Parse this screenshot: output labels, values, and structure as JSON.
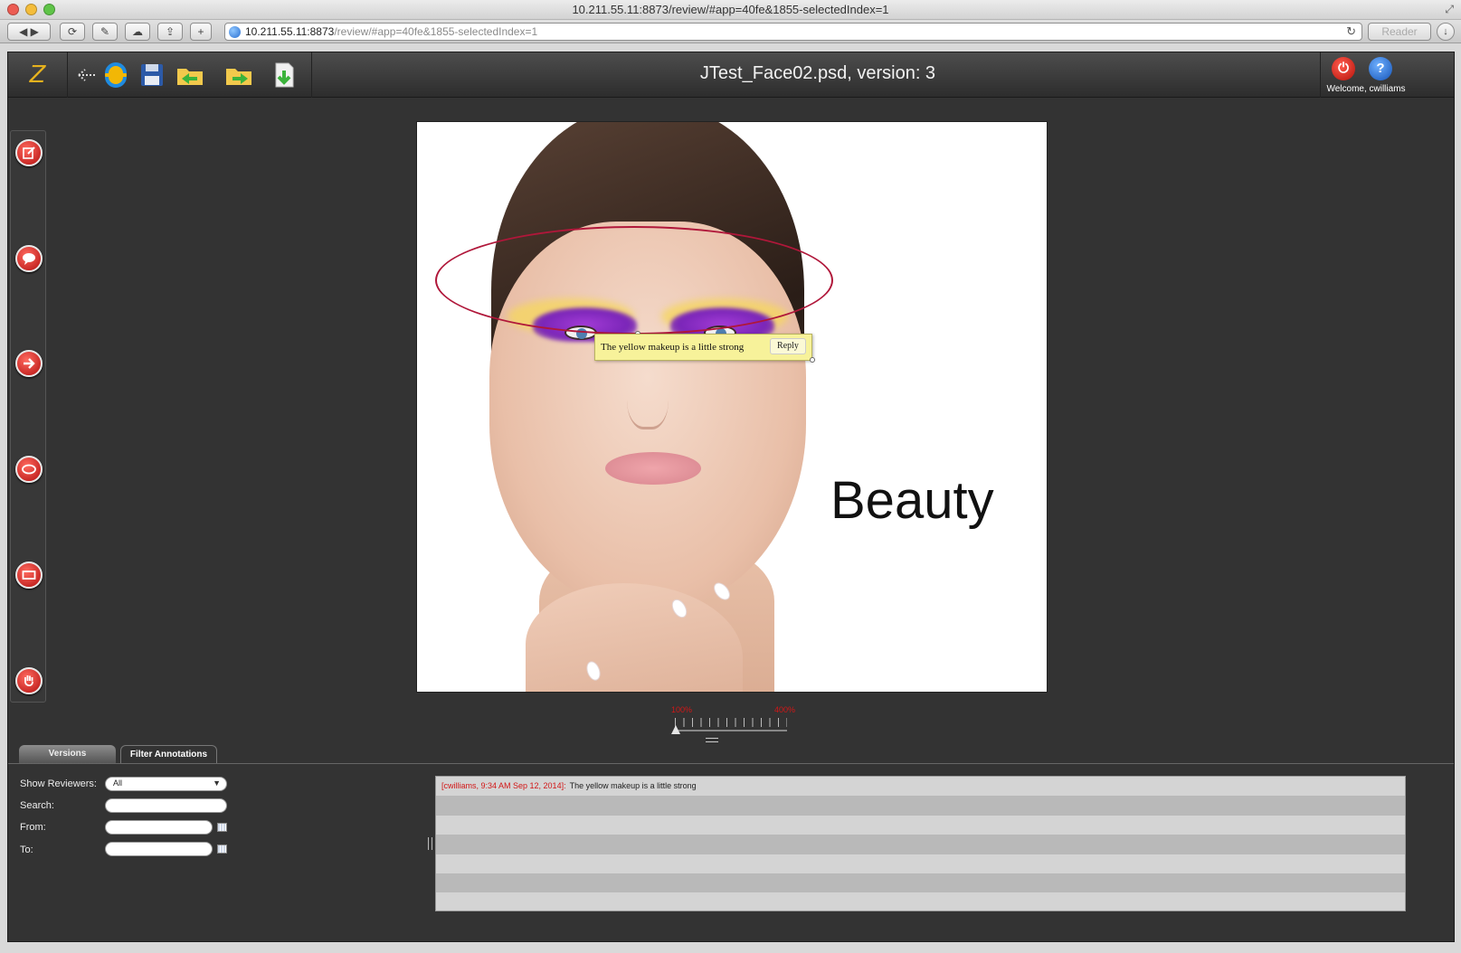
{
  "browser": {
    "window_title": "10.211.55.11:8873/review/#app=40fe&1855-selectedIndex=1",
    "url_host": "10.211.55.11:8873",
    "url_path": "/review/#app=40fe&1855-selectedIndex=1",
    "reader_label": "Reader"
  },
  "app": {
    "logo": "Z",
    "title": "JTest_Face02.psd, version: 3",
    "welcome": "Welcome, cwilliams"
  },
  "canvas": {
    "artwork_text": "Beauty",
    "note": {
      "text": "The yellow makeup is a little strong",
      "reply_label": "Reply"
    }
  },
  "zoom": {
    "min_label": "100%",
    "max_label": "400%",
    "level_fraction": 0.0
  },
  "tabs": [
    {
      "label": "Versions"
    },
    {
      "label": "Filter Annotations"
    }
  ],
  "filters": {
    "reviewers_label": "Show Reviewers:",
    "reviewers_value": "All",
    "search_label": "Search:",
    "from_label": "From:",
    "to_label": "To:"
  },
  "annotations": [
    {
      "who": "[cwilliams, 9:34 AM Sep 12, 2014]:",
      "text": "The yellow makeup is a little strong"
    }
  ],
  "colors": {
    "accent_red": "#d21717",
    "logo_yellow": "#e6b21e",
    "note_bg": "#f7f29a",
    "annotation_stroke": "#b0173a"
  }
}
